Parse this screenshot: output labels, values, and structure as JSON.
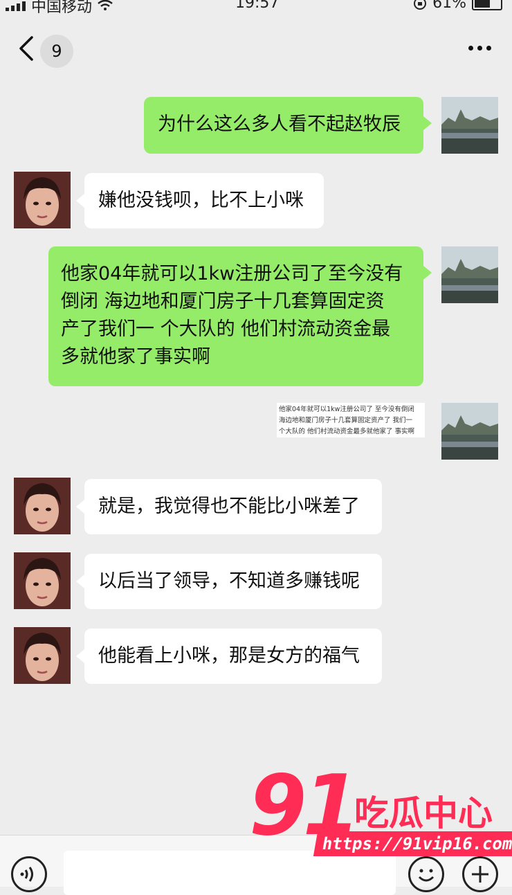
{
  "status_bar": {
    "carrier": "中国移动",
    "time": "19:57",
    "battery": "61%"
  },
  "header": {
    "unread_count": "9"
  },
  "messages": [
    {
      "side": "me",
      "text": "为什么这么多人看不起赵牧辰"
    },
    {
      "side": "other",
      "text": "嫌他没钱呗，比不上小咪"
    },
    {
      "side": "me",
      "lines": [
        "他家04年就可以1kw注册公司了至今没有",
        "倒闭 海边地和厦门房子十几套算固定资",
        "产了我们一 个大队的 他们村流动资金最",
        "多就他家了事实啊"
      ]
    },
    {
      "side": "me",
      "type": "image",
      "lines": [
        "他家04年就可以1kw注册公司了 至今没有倒闭",
        "海边地和厦门房子十几套算固定资产了 我们一",
        "个大队的 他们村流动资金最多就他家了 事实啊"
      ]
    },
    {
      "side": "other",
      "text": "就是，我觉得也不能比小咪差了"
    },
    {
      "side": "other",
      "text": "以后当了领导，不知道多赚钱呢"
    },
    {
      "side": "other",
      "text": "他能看上小咪，那是女方的福气"
    }
  ],
  "watermark": {
    "number": "91",
    "name": "吃瓜中心",
    "url": "https://91vip16.com"
  },
  "colors": {
    "background": "#ededed",
    "my_bubble": "#95ec69",
    "their_bubble": "#ffffff",
    "watermark": "#ff2d55"
  }
}
